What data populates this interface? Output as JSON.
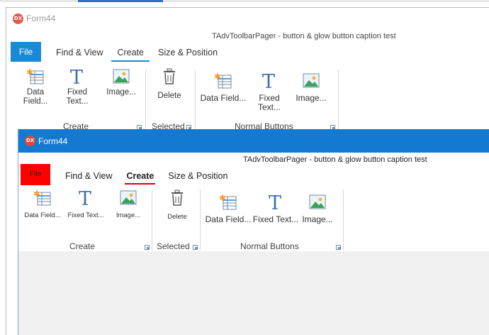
{
  "outer_window": {
    "title": "Form44",
    "logo": "DX",
    "caption": "TAdvToolbarPager - button & glow button caption test",
    "file_tab": "File",
    "tabs": [
      "Find & View",
      "Create",
      "Size & Position"
    ],
    "active_tab": "Create",
    "buttons": {
      "data_field": "Data\nField...",
      "fixed_text": "Fixed\nText...",
      "image": "Image...",
      "delete": "Delete",
      "data_field_n": "Data Field...",
      "fixed_text_n": "Fixed Text...",
      "image_n": "Image..."
    },
    "groups": [
      "Create",
      "Selected",
      "Normal Buttons"
    ],
    "file_color": "#1a8ad8"
  },
  "inner_window": {
    "title": "Form44",
    "logo": "DX",
    "caption": "TAdvToolbarPager - button & glow button caption test",
    "file_tab": "File",
    "tabs": [
      "Find & View",
      "Create",
      "Size & Position"
    ],
    "active_tab": "Create",
    "buttons": {
      "data_field": "Data Field...",
      "fixed_text": "Fixed Text...",
      "image": "Image...",
      "delete": "Delete",
      "data_field_n": "Data Field...",
      "fixed_text_n": "Fixed Text...",
      "image_n": "Image..."
    },
    "groups": [
      "Create",
      "Selected",
      "Normal Buttons"
    ],
    "titlebar_color": "#1479d0",
    "file_color": "#ff0000"
  },
  "icons": [
    "data-field-icon",
    "fixed-text-icon",
    "image-icon",
    "delete-icon",
    "dialog-launcher-icon"
  ]
}
